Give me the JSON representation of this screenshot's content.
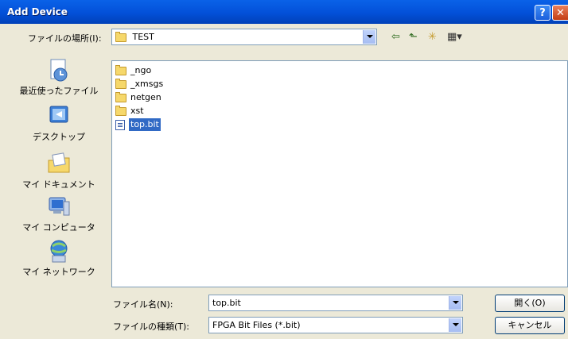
{
  "window": {
    "title": "Add Device",
    "help": "?",
    "close": "✕"
  },
  "lookin": {
    "label": "ファイルの場所(I):",
    "value": "TEST"
  },
  "toolbar": {
    "back": "⇦",
    "up": "⬑",
    "new_folder": "✳",
    "views": "▦▾"
  },
  "places": [
    {
      "label": "最近使ったファイル",
      "icon": "recent-documents-icon"
    },
    {
      "label": "デスクトップ",
      "icon": "desktop-icon"
    },
    {
      "label": "マイ ドキュメント",
      "icon": "my-documents-icon"
    },
    {
      "label": "マイ コンピュータ",
      "icon": "my-computer-icon"
    },
    {
      "label": "マイ ネットワーク",
      "icon": "my-network-icon"
    }
  ],
  "files": [
    {
      "name": "_ngo",
      "type": "folder"
    },
    {
      "name": "_xmsgs",
      "type": "folder"
    },
    {
      "name": "netgen",
      "type": "folder"
    },
    {
      "name": "xst",
      "type": "folder"
    },
    {
      "name": "top.bit",
      "type": "bit",
      "selected": true
    }
  ],
  "filename": {
    "label": "ファイル名(N):",
    "value": "top.bit"
  },
  "filetype": {
    "label": "ファイルの種類(T):",
    "value": "FPGA Bit Files (*.bit)"
  },
  "buttons": {
    "open": "開く(O)",
    "cancel": "キャンセル"
  }
}
